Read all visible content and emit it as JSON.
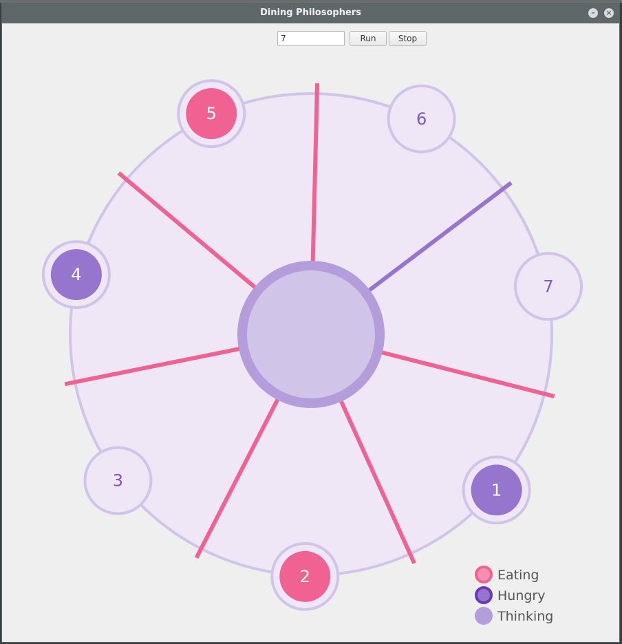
{
  "window": {
    "title": "Dining Philosophers"
  },
  "controls": {
    "count_value": "7",
    "run_label": "Run",
    "stop_label": "Stop",
    "minimize_glyph": "–",
    "close_glyph": "×"
  },
  "colors": {
    "eating": "#f06292",
    "hungry": "#9575cd",
    "thinking_fill": "#efe7f5",
    "ring": "#d1c4e9",
    "table": "#d1c4e9",
    "table_border": "#b39ddb",
    "number_on_light": "#7e57c2",
    "number_on_dark": "#ffffff"
  },
  "philosophers": [
    {
      "label": "1",
      "state": "hungry"
    },
    {
      "label": "2",
      "state": "eating"
    },
    {
      "label": "3",
      "state": "thinking"
    },
    {
      "label": "4",
      "state": "hungry"
    },
    {
      "label": "5",
      "state": "eating"
    },
    {
      "label": "6",
      "state": "thinking"
    },
    {
      "label": "7",
      "state": "thinking"
    }
  ],
  "forks": [
    {
      "state": "eating"
    },
    {
      "state": "eating"
    },
    {
      "state": "eating"
    },
    {
      "state": "eating"
    },
    {
      "state": "eating"
    },
    {
      "state": "hungry"
    },
    {
      "state": "eating"
    }
  ],
  "legend": [
    {
      "label": "Eating",
      "state": "eating"
    },
    {
      "label": "Hungry",
      "state": "hungry"
    },
    {
      "label": "Thinking",
      "state": "thinking"
    }
  ]
}
